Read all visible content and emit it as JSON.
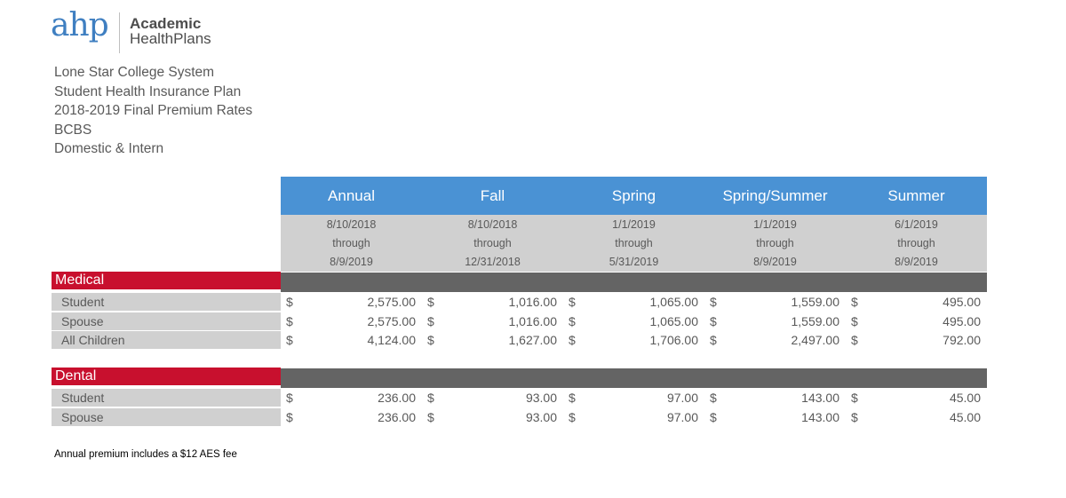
{
  "logo": {
    "mark": "ahp",
    "line1": "Academic",
    "line2": "HealthPlans"
  },
  "header_lines": [
    "Lone Star College System",
    "Student Health Insurance Plan",
    "2018-2019 Final Premium Rates",
    "BCBS",
    "Domestic & Intern"
  ],
  "columns": [
    {
      "title": "Annual",
      "dates": [
        "8/10/2018",
        "through",
        "8/9/2019"
      ]
    },
    {
      "title": "Fall",
      "dates": [
        "8/10/2018",
        "through",
        "12/31/2018"
      ]
    },
    {
      "title": "Spring",
      "dates": [
        "1/1/2019",
        "through",
        "5/31/2019"
      ]
    },
    {
      "title": "Spring/Summer",
      "dates": [
        "1/1/2019",
        "through",
        "8/9/2019"
      ]
    },
    {
      "title": "Summer",
      "dates": [
        "6/1/2019",
        "through",
        "8/9/2019"
      ]
    }
  ],
  "sections": [
    {
      "name": "Medical",
      "rows": [
        {
          "label": "Student",
          "values": [
            "2,575.00",
            "1,016.00",
            "1,065.00",
            "1,559.00",
            "495.00"
          ]
        },
        {
          "label": "Spouse",
          "values": [
            "2,575.00",
            "1,016.00",
            "1,065.00",
            "1,559.00",
            "495.00"
          ]
        },
        {
          "label": "All Children",
          "values": [
            "4,124.00",
            "1,627.00",
            "1,706.00",
            "2,497.00",
            "792.00"
          ]
        }
      ]
    },
    {
      "name": "Dental",
      "rows": [
        {
          "label": "Student",
          "values": [
            "236.00",
            "93.00",
            "97.00",
            "143.00",
            "45.00"
          ]
        },
        {
          "label": "Spouse",
          "values": [
            "236.00",
            "93.00",
            "97.00",
            "143.00",
            "45.00"
          ]
        }
      ]
    }
  ],
  "currency_symbol": "$",
  "footnote": "Annual premium includes a $12 AES fee",
  "colors": {
    "header_blue": "#4a92d4",
    "section_red": "#c8102e",
    "band_dark": "#646464",
    "band_light": "#d0d0d0",
    "logo_blue": "#3f7fc1"
  }
}
